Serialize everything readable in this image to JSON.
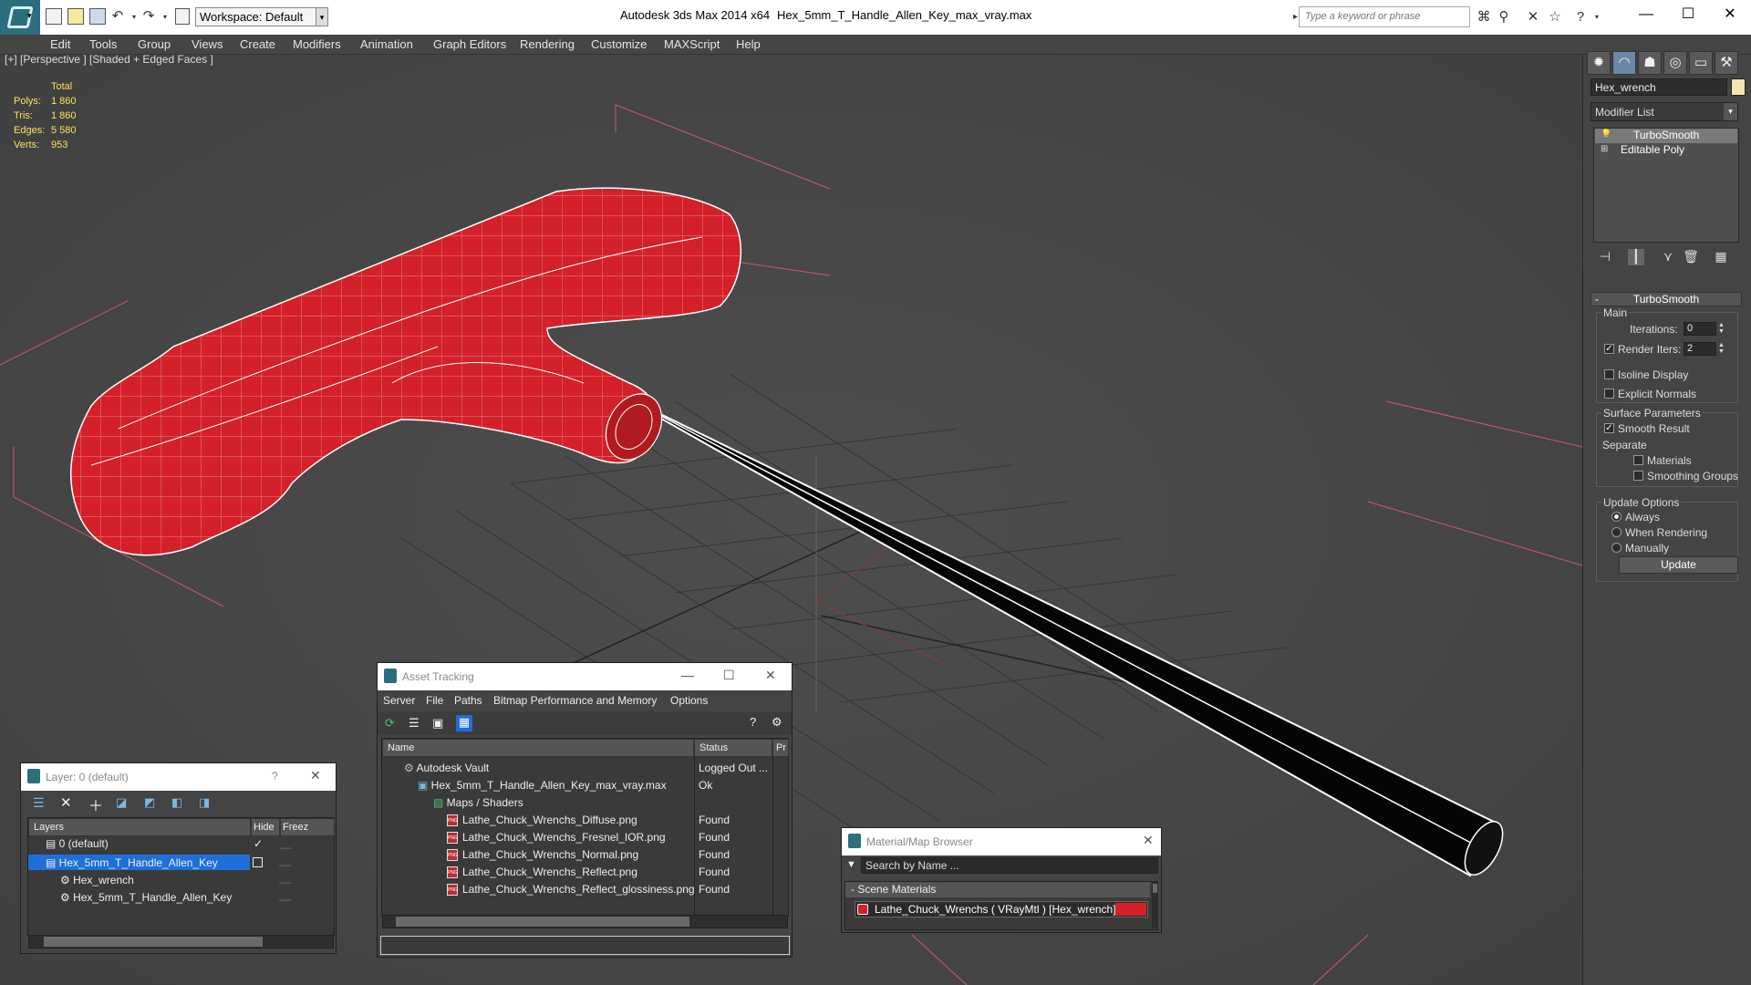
{
  "titlebar": {
    "workspace": "Workspace: Default",
    "app_title": "Autodesk 3ds Max  2014 x64",
    "file_title": "Hex_5mm_T_Handle_Allen_Key_max_vray.max",
    "search_placeholder": "Type a keyword or phrase"
  },
  "menu": [
    "Edit",
    "Tools",
    "Group",
    "Views",
    "Create",
    "Modifiers",
    "Animation",
    "Graph Editors",
    "Rendering",
    "Customize",
    "MAXScript",
    "Help"
  ],
  "viewport": {
    "label": "[+] [Perspective ] [Shaded + Edged Faces ]",
    "stats": {
      "total_label": "Total",
      "polys_label": "Polys:",
      "polys": "1 860",
      "tris_label": "Tris:",
      "tris": "1 860",
      "edges_label": "Edges:",
      "edges": "5 580",
      "verts_label": "Verts:",
      "verts": "953"
    }
  },
  "command_panel": {
    "object_name": "Hex_wrench",
    "modifier_list": "Modifier List",
    "stack": [
      "TurboSmooth",
      "Editable Poly"
    ],
    "rollout_title": "TurboSmooth",
    "main_label": "Main",
    "iterations_label": "Iterations:",
    "iterations": "0",
    "render_iters_label": "Render Iters:",
    "render_iters": "2",
    "isoline_label": "Isoline Display",
    "explicit_normals_label": "Explicit Normals",
    "surface_params_label": "Surface Parameters",
    "smooth_result_label": "Smooth Result",
    "separate_label": "Separate",
    "materials_label": "Materials",
    "smoothing_groups_label": "Smoothing Groups",
    "update_options_label": "Update Options",
    "always_label": "Always",
    "when_rendering_label": "When Rendering",
    "manually_label": "Manually",
    "update_button": "Update"
  },
  "layer_window": {
    "title": "Layer: 0 (default)",
    "help": "?",
    "col_layers": "Layers",
    "col_hide": "Hide",
    "col_freeze": "Freez",
    "rows": [
      "0 (default)",
      "Hex_5mm_T_Handle_Allen_Key",
      "Hex_wrench",
      "Hex_5mm_T_Handle_Allen_Key"
    ]
  },
  "asset_window": {
    "title": "Asset Tracking",
    "menu": [
      "Server",
      "File",
      "Paths",
      "Bitmap Performance and Memory",
      "Options"
    ],
    "col_name": "Name",
    "col_status": "Status",
    "col_pr": "Pr",
    "rows": [
      {
        "name": "Autodesk Vault",
        "status": "Logged Out ..."
      },
      {
        "name": "Hex_5mm_T_Handle_Allen_Key_max_vray.max",
        "status": "Ok"
      },
      {
        "name": "Maps / Shaders",
        "status": ""
      },
      {
        "name": "Lathe_Chuck_Wrenchs_Diffuse.png",
        "status": "Found"
      },
      {
        "name": "Lathe_Chuck_Wrenchs_Fresnel_IOR.png",
        "status": "Found"
      },
      {
        "name": "Lathe_Chuck_Wrenchs_Normal.png",
        "status": "Found"
      },
      {
        "name": "Lathe_Chuck_Wrenchs_Reflect.png",
        "status": "Found"
      },
      {
        "name": "Lathe_Chuck_Wrenchs_Reflect_glossiness.png",
        "status": "Found"
      }
    ]
  },
  "material_window": {
    "title": "Material/Map Browser",
    "search_placeholder": "Search by Name ...",
    "section": "- Scene Materials",
    "item": "Lathe_Chuck_Wrenchs  ( VRayMtl )  [Hex_wrench]"
  },
  "colors": {
    "accent": "#2b6f7e",
    "model_red": "#d42028",
    "selection": "#1e6fd9"
  }
}
